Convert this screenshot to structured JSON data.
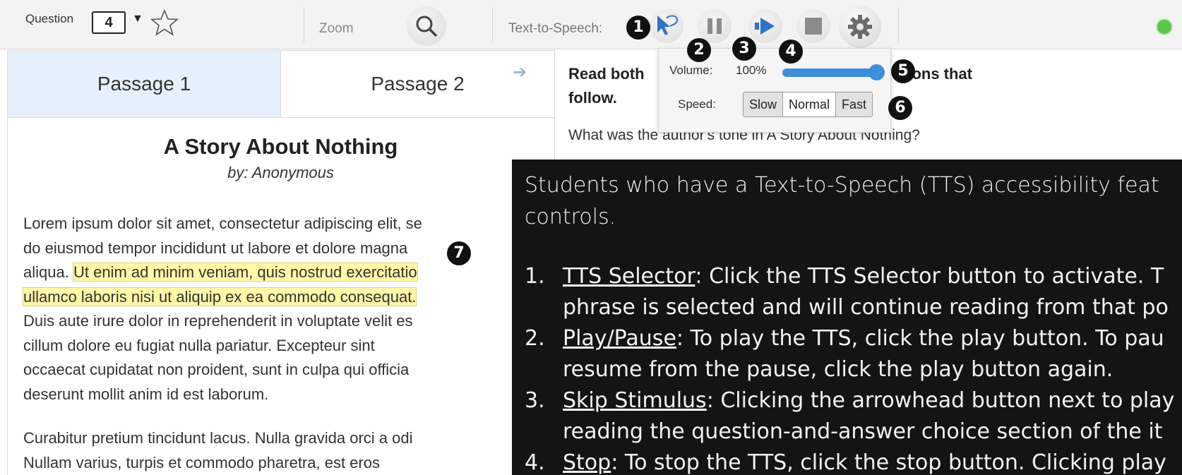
{
  "toolbar": {
    "question_label": "Question",
    "question_number": "4",
    "question_caret": "▼",
    "zoom_label": "Zoom",
    "tts_label": "Text-to-Speech:",
    "badges": [
      "1",
      "2",
      "3",
      "4",
      "5",
      "6",
      "7"
    ],
    "status_color": "#5cc54b"
  },
  "tabs": [
    {
      "label": "Passage 1",
      "active": true
    },
    {
      "label": "Passage 2",
      "active": false
    }
  ],
  "passage": {
    "title": "A Story About Nothing",
    "author": "by: Anonymous",
    "lines": [
      "Lorem ipsum dolor sit amet, consectetur adipiscing elit, se",
      "do eiusmod tempor incididunt ut labore et dolore magna",
      "Duis aute irure dolor in reprehenderit in voluptate velit es",
      "cillum dolore eu fugiat nulla pariatur. Excepteur sint",
      "occaecat cupidatat non proident, sunt in culpa qui officia",
      "deserunt mollit anim id est laborum.",
      "Curabitur pretium tincidunt lacus. Nulla gravida orci a odi",
      "Nullam varius, turpis et commodo pharetra, est eros"
    ],
    "line3_plain": "aliqua.",
    "line3_highlight": "Ut enim ad minim veniam, quis nostrud exercitatio",
    "line4_highlight": "ullamco laboris nisi ut aliquip ex ea commodo consequat."
  },
  "question": {
    "intro_line1": "Read both",
    "intro_line2": "follow.",
    "intro_suffix": "tions that",
    "text": "What was the author's tone in A Story About Nothing?"
  },
  "tts_popup": {
    "volume_label": "Volume:",
    "volume_value": "100%",
    "volume_level": 1.0,
    "speed_label": "Speed:",
    "speed_options": [
      "Slow",
      "Normal",
      "Fast"
    ],
    "speed_selected": "Normal"
  },
  "overlay": {
    "intro_line1": "Students who have a Text-to-Speech (TTS) accessibility feat",
    "intro_line2": "controls.",
    "items": [
      {
        "num": "1.",
        "term": "TTS Selector",
        "line1": ": Click the TTS Selector button to activate. T",
        "line2": "phrase is selected and will continue reading from that po"
      },
      {
        "num": "2.",
        "term": "Play/Pause",
        "line1": ": To play the TTS, click the play button. To pau",
        "line2": "resume from the pause, click the play button again."
      },
      {
        "num": "3.",
        "term": "Skip Stimulus",
        "line1": ": Clicking the arrowhead button next to play",
        "line2": "reading the question-and-answer choice section of the it"
      },
      {
        "num": "4.",
        "term": "Stop",
        "line1": ": To stop the TTS, click the stop button. Clicking play",
        "line2": ""
      }
    ]
  }
}
